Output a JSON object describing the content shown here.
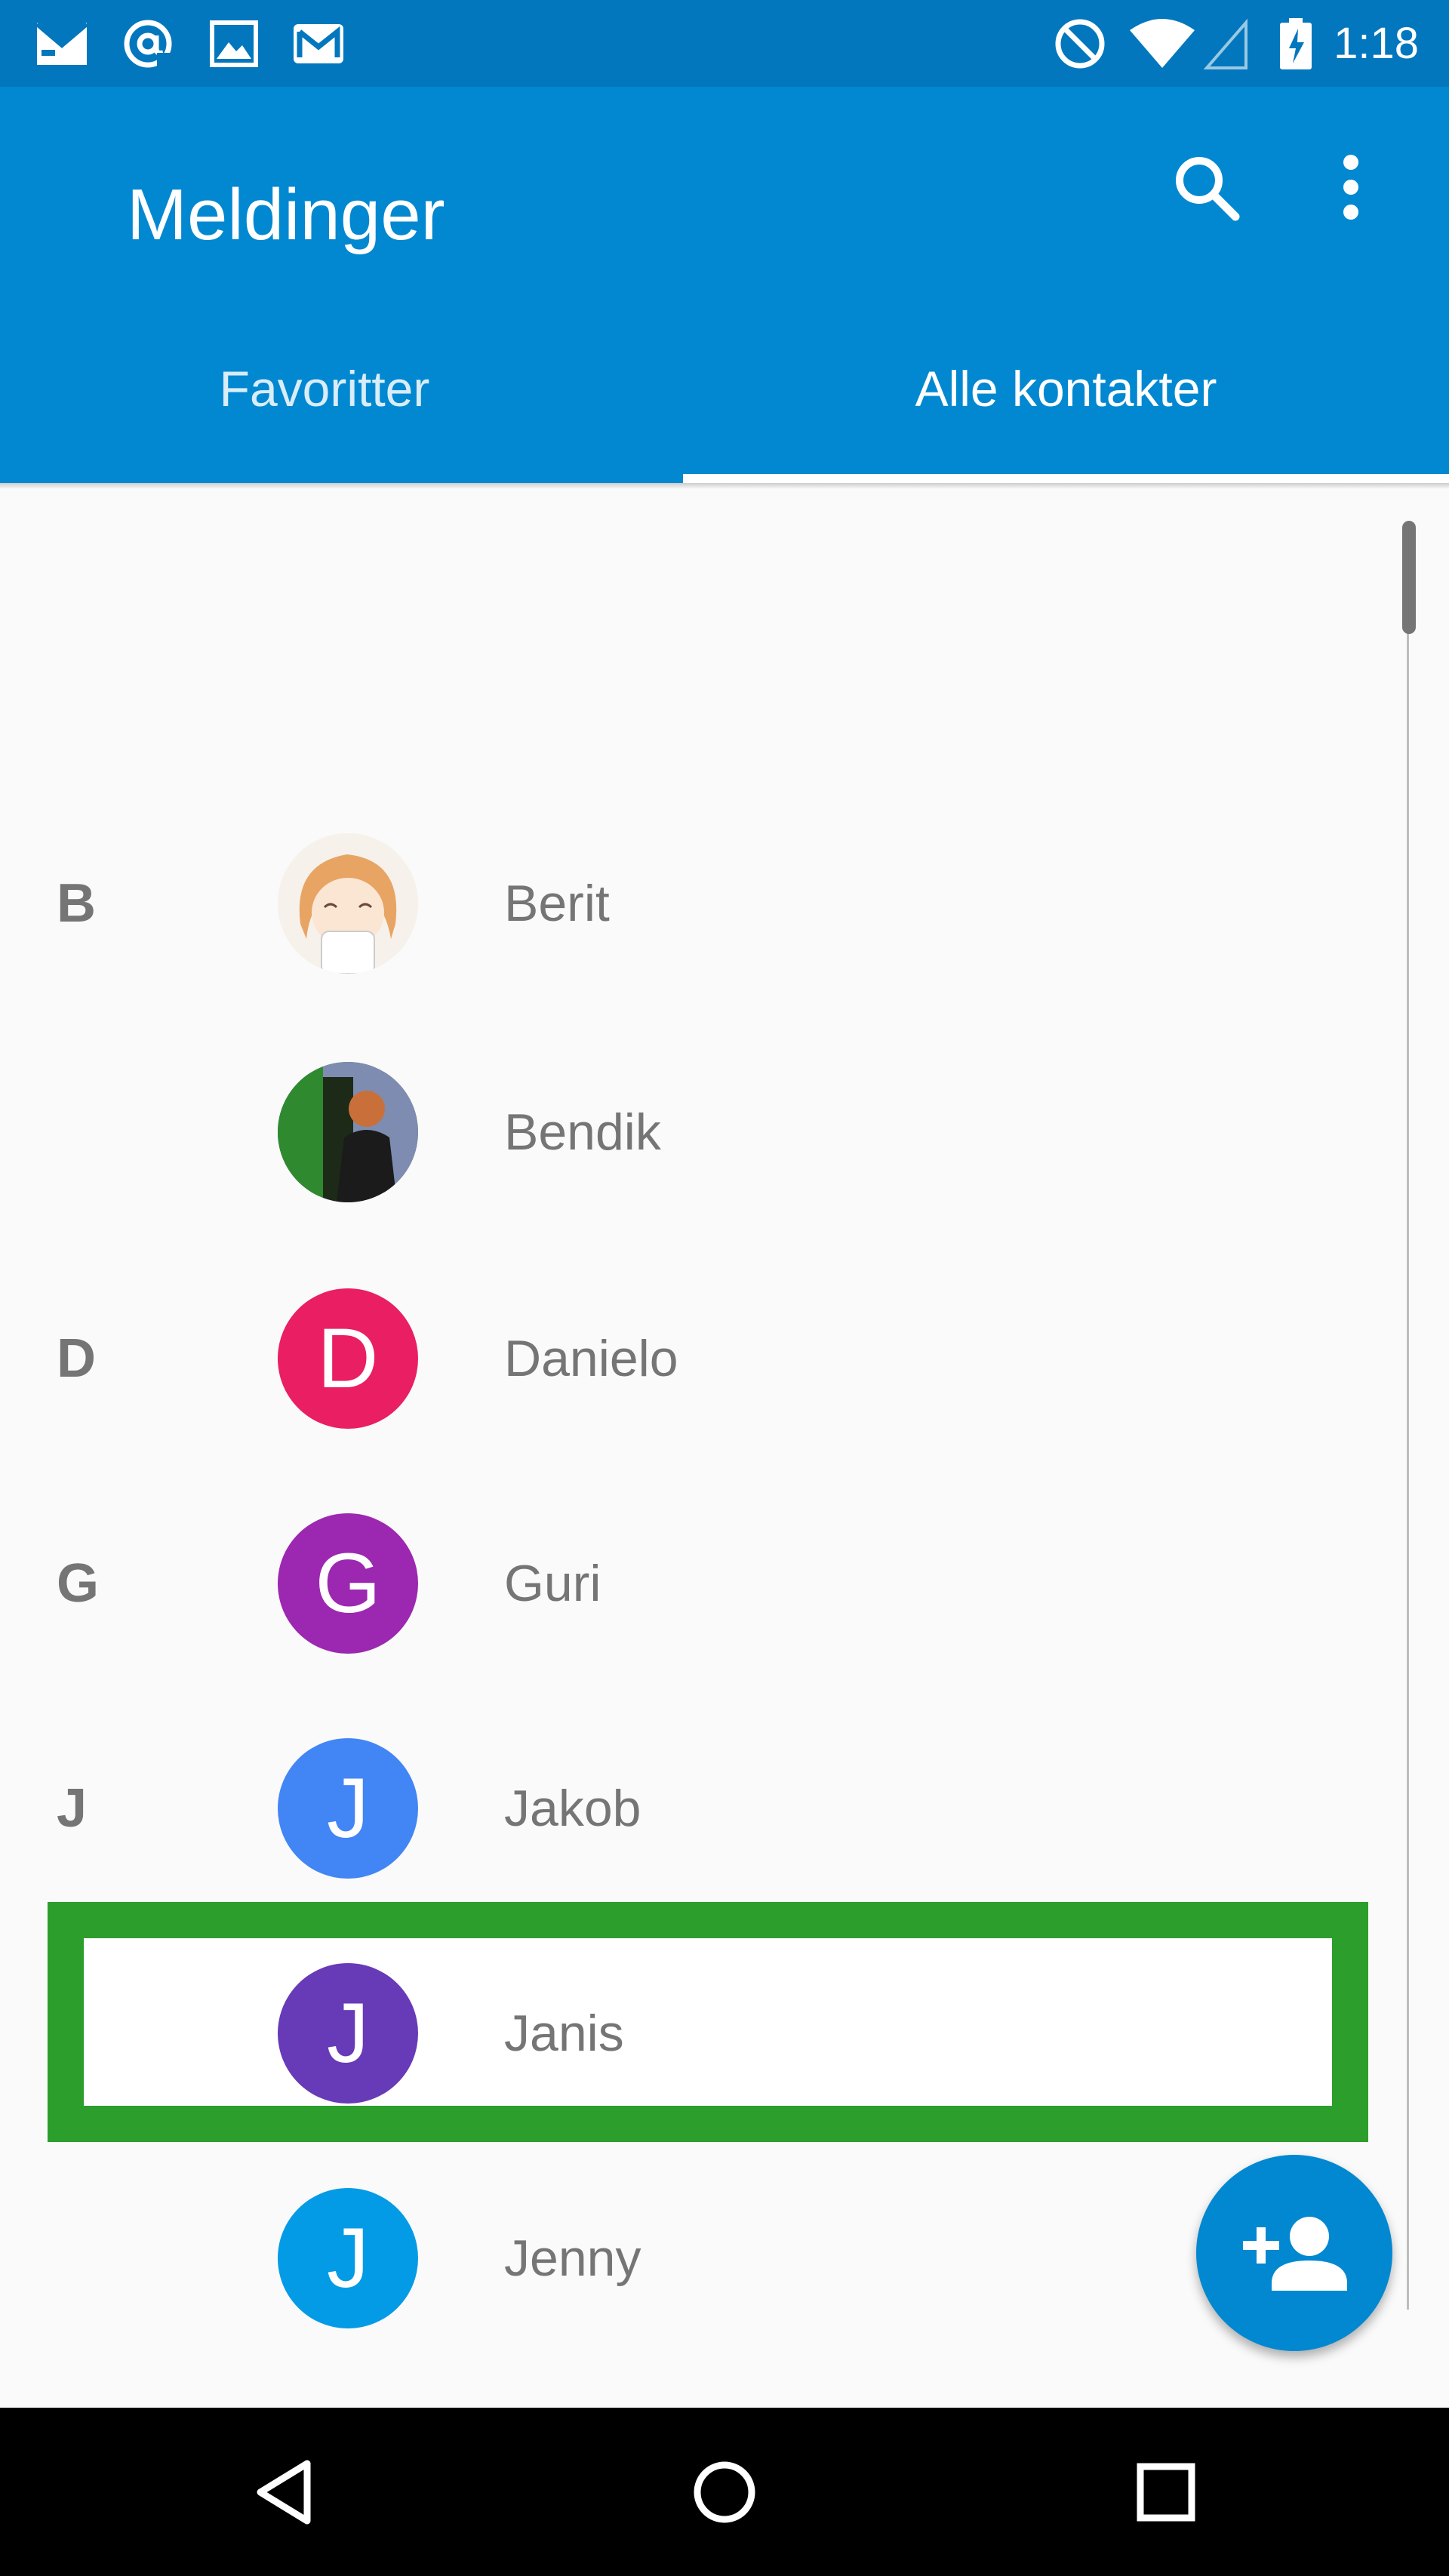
{
  "status_bar": {
    "time": "1:18",
    "left_icons": [
      "email-notification-icon",
      "at-sign-icon",
      "image-icon",
      "gmail-icon"
    ],
    "right_icons": [
      "do-not-disturb-icon",
      "wifi-icon",
      "cellular-signal-icon",
      "battery-charging-icon"
    ]
  },
  "app_bar": {
    "title": "Meldinger",
    "actions": [
      "search-icon",
      "more-vert-icon"
    ],
    "color": "#0288d1",
    "status_color": "#0277bd"
  },
  "tabs": [
    {
      "label": "Favoritter",
      "selected": false
    },
    {
      "label": "Alle kontakter",
      "selected": true
    }
  ],
  "contacts": [
    {
      "letter": "B",
      "name": "Berit",
      "avatar": "photo",
      "initial": "",
      "color": "#f0e6d8"
    },
    {
      "letter": "",
      "name": "Bendik",
      "avatar": "photo",
      "initial": "",
      "color": "#3a4a30"
    },
    {
      "letter": "D",
      "name": "Danielo",
      "avatar": "initial",
      "initial": "D",
      "color": "#e91e63"
    },
    {
      "letter": "G",
      "name": "Guri",
      "avatar": "initial",
      "initial": "G",
      "color": "#9c27b0"
    },
    {
      "letter": "J",
      "name": "Jakob",
      "avatar": "initial",
      "initial": "J",
      "color": "#4285f4"
    },
    {
      "letter": "",
      "name": "Janis",
      "avatar": "initial",
      "initial": "J",
      "color": "#673ab7",
      "highlighted": true
    },
    {
      "letter": "",
      "name": "Jenny",
      "avatar": "initial",
      "initial": "J",
      "color": "#039be5"
    }
  ],
  "highlight_color": "#2c9e2c",
  "fab": {
    "icon": "add-person-icon",
    "color": "#0288d1"
  },
  "nav_bar": {
    "buttons": [
      "back-icon",
      "home-icon",
      "recents-icon"
    ]
  }
}
